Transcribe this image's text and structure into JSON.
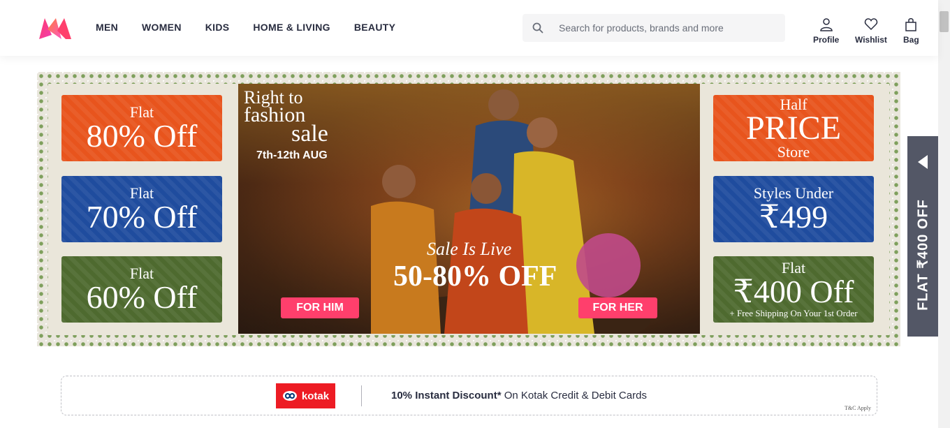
{
  "header": {
    "nav": [
      "MEN",
      "WOMEN",
      "KIDS",
      "HOME & LIVING",
      "BEAUTY"
    ],
    "search_placeholder": "Search for products, brands and more",
    "actions": {
      "profile": "Profile",
      "wishlist": "Wishlist",
      "bag": "Bag"
    }
  },
  "banner": {
    "left_tiles": [
      {
        "line1": "Flat",
        "line2": "80% Off"
      },
      {
        "line1": "Flat",
        "line2": "70% Off"
      },
      {
        "line1": "Flat",
        "line2": "60% Off"
      }
    ],
    "hero": {
      "title_line1": "Right to",
      "title_line2": "fashion",
      "title_line3": "sale",
      "dates": "7th-12th AUG",
      "live": "Sale Is Live",
      "discount": "50-80% OFF",
      "button_him": "FOR HIM",
      "button_her": "FOR HER"
    },
    "right_tiles": [
      {
        "line1": "Half",
        "line2": "PRICE",
        "line3": "Store"
      },
      {
        "line1": "Styles Under",
        "line2": "₹499"
      },
      {
        "line1": "Flat",
        "line2": "₹400 Off",
        "line3": "+ Free Shipping On Your 1st Order"
      }
    ]
  },
  "side_tab": {
    "text": "FLAT ₹400 OFF"
  },
  "kotak": {
    "brand": "kotak",
    "bold_text": "10% Instant Discount*",
    "rest_text": " On Kotak Credit & Debit Cards",
    "tc": "T&C Apply"
  },
  "colors": {
    "accent": "#ff3f6c",
    "text": "#282c3f",
    "orange": "#e8541d",
    "blue": "#1f4c9e",
    "green": "#4e6a2f"
  }
}
